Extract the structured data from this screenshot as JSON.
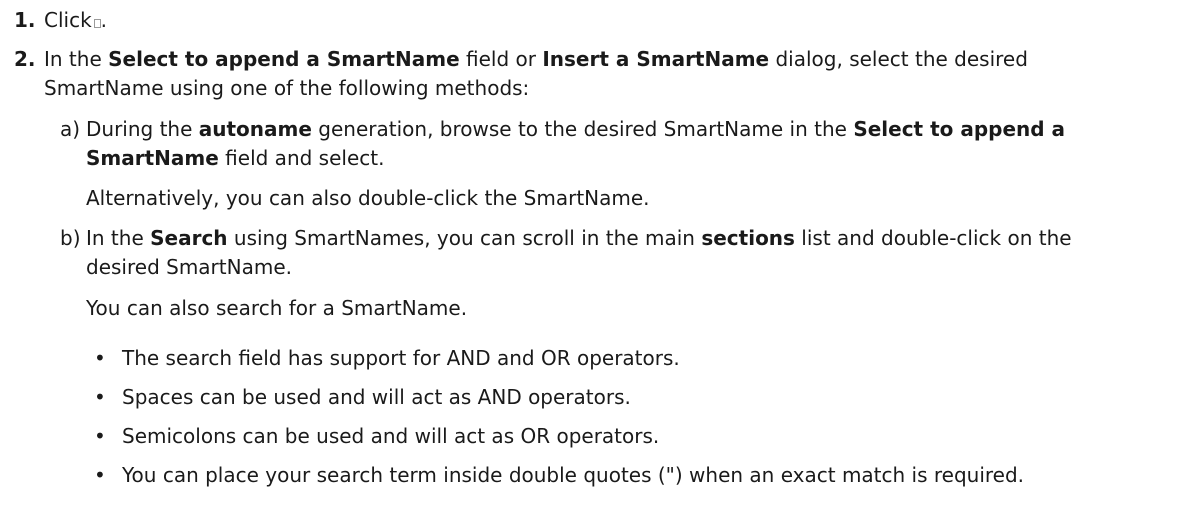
{
  "steps": [
    {
      "number": "1.",
      "prefix": "Click",
      "suffix": ".",
      "icon": "smartname-insert-icon"
    },
    {
      "number": "2.",
      "t1": "In the ",
      "b1": "Select to append a SmartName",
      "t2": " field or ",
      "b2": "Insert a SmartName",
      "t3": " dialog, select the desired",
      "line2": "SmartName using one of the following methods:",
      "substeps": [
        {
          "letter": "a)",
          "t1": "During the ",
          "b1": "autoname",
          "t2": " generation, browse to the desired SmartName in the ",
          "b2": "Select to append a",
          "b3": "SmartName",
          "t3": " field and select.",
          "note": "Alternatively, you can also double-click the SmartName."
        },
        {
          "letter": "b)",
          "t1": "In the ",
          "b1": "Search",
          "t2": " using SmartNames, you can scroll in the main ",
          "b2": "sections",
          "t3": " list and double-click on the",
          "line2": "desired SmartName.",
          "note": "You can also search for a SmartName.",
          "bullets": [
            "The search field has support for AND and OR operators.",
            "Spaces can be used and will act as AND operators.",
            "Semicolons can be used and will act as OR operators.",
            "You can place your search term inside double quotes (\") when an exact match is required."
          ]
        }
      ]
    }
  ]
}
